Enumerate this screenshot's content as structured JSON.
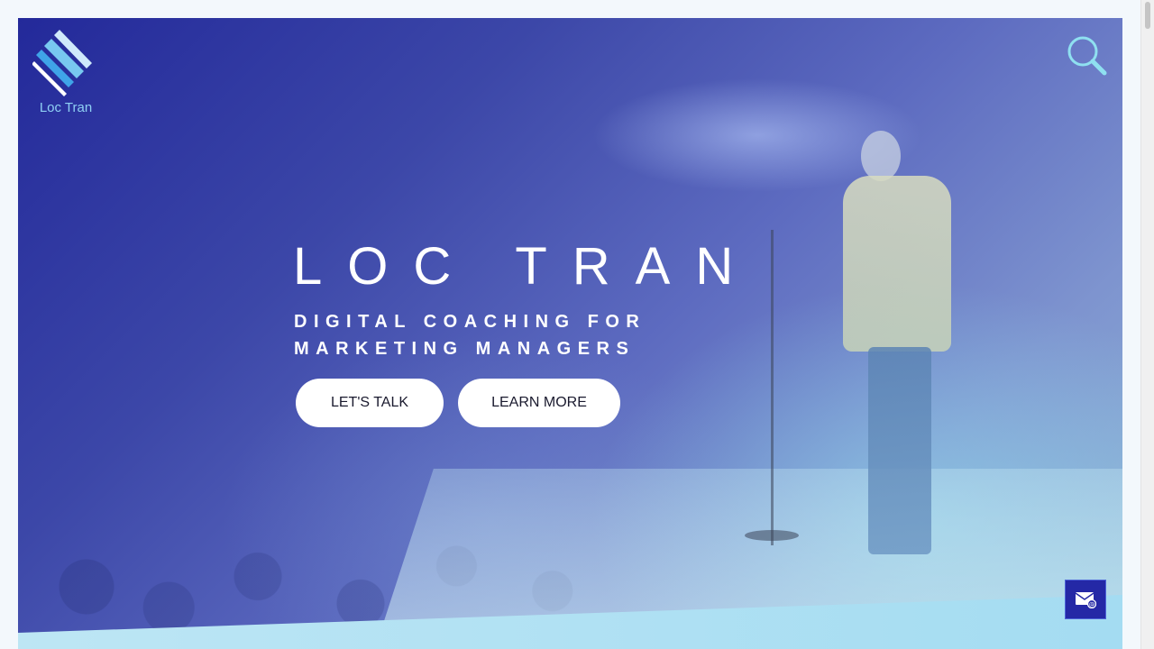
{
  "brand": {
    "name": "Loc Tran",
    "logo_icon": "stacked-stripes-logo-icon"
  },
  "header": {
    "search_icon": "search-icon"
  },
  "hero": {
    "title": "LOC TRAN",
    "subtitle_line1": "DIGITAL COACHING FOR",
    "subtitle_line2": "MARKETING MANAGERS",
    "primary_button": "LET'S TALK",
    "secondary_button": "LEARN MORE"
  },
  "floating": {
    "contact_icon": "mail-icon"
  },
  "colors": {
    "accent": "#2428a6",
    "logo_text": "#8fd0f4",
    "band": "#a4dcf2"
  }
}
